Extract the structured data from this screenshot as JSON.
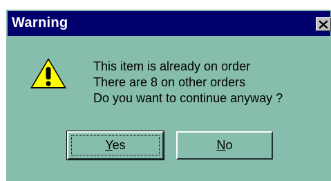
{
  "dialog": {
    "title": "Warning",
    "close_icon": "close-icon",
    "icon": "warning-triangle-icon",
    "message_lines": [
      "This item is already on order",
      "There are 8 on other orders",
      "Do you want to continue anyway ?"
    ],
    "buttons": {
      "yes": {
        "mnemonic": "Y",
        "rest": "es"
      },
      "no": {
        "mnemonic": "N",
        "rest": "o"
      }
    }
  },
  "colors": {
    "dialog_background": "#86bdac",
    "titlebar": "#02006c",
    "title_text": "#ffffff",
    "warning_icon_fill": "#ffff00"
  }
}
